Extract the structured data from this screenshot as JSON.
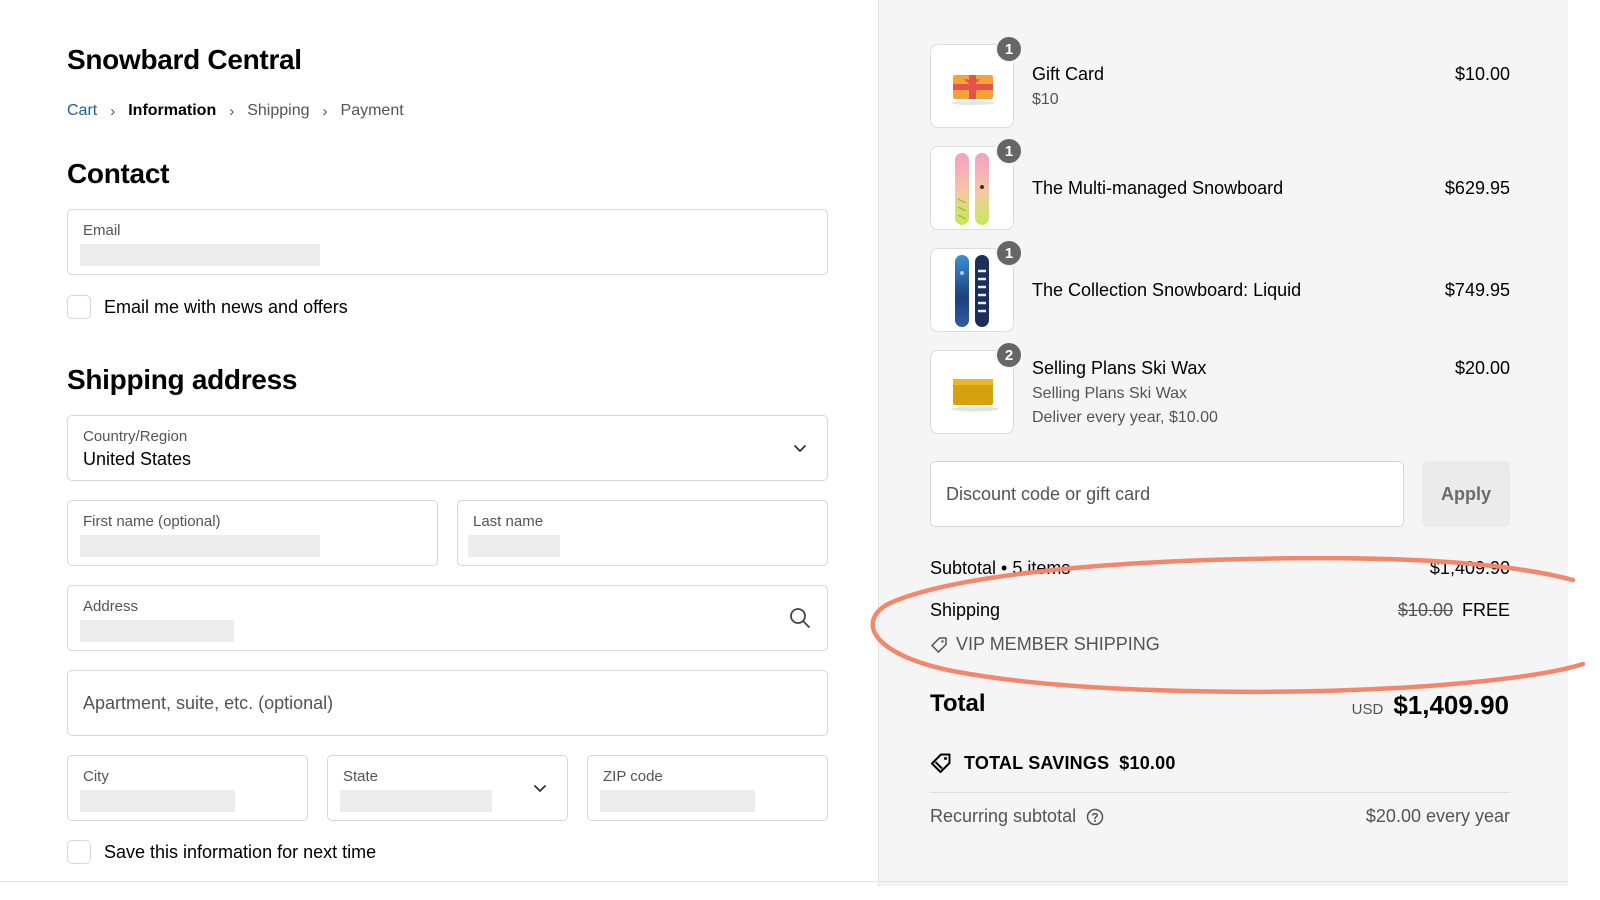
{
  "store": {
    "name": "Snowbard Central"
  },
  "breadcrumb": [
    {
      "label": "Cart",
      "state": "link"
    },
    {
      "label": "Information",
      "state": "current"
    },
    {
      "label": "Shipping",
      "state": "upcoming"
    },
    {
      "label": "Payment",
      "state": "upcoming"
    }
  ],
  "contact": {
    "heading": "Contact",
    "email_label": "Email",
    "newsletter_label": "Email me with news and offers"
  },
  "shipping_address": {
    "heading": "Shipping address",
    "country_label": "Country/Region",
    "country_value": "United States",
    "first_name_label": "First name (optional)",
    "last_name_label": "Last name",
    "address_label": "Address",
    "apartment_placeholder": "Apartment, suite, etc. (optional)",
    "city_label": "City",
    "state_label": "State",
    "zip_label": "ZIP code",
    "save_info_label": "Save this information for next time"
  },
  "order": {
    "items": [
      {
        "name": "Gift Card",
        "sub": [
          "$10"
        ],
        "price": "$10.00",
        "qty": "1",
        "icon": "gift-card-icon"
      },
      {
        "name": "The Multi-managed Snowboard",
        "sub": [],
        "price": "$629.95",
        "qty": "1",
        "icon": "snowboard-icon"
      },
      {
        "name": "The Collection Snowboard: Liquid",
        "sub": [],
        "price": "$749.95",
        "qty": "1",
        "icon": "snowboard-icon"
      },
      {
        "name": "Selling Plans Ski Wax",
        "sub": [
          "Selling Plans Ski Wax",
          "Deliver every year, $10.00"
        ],
        "price": "$20.00",
        "qty": "2",
        "icon": "ski-wax-icon"
      }
    ],
    "discount_placeholder": "Discount code or gift card",
    "apply_label": "Apply",
    "subtotal_label": "Subtotal • 5 items",
    "subtotal_value": "$1,409.90",
    "shipping_label": "Shipping",
    "shipping_original": "$10.00",
    "shipping_value": "FREE",
    "shipping_discount_name": "VIP MEMBER SHIPPING",
    "total_label": "Total",
    "total_currency": "USD",
    "total_value": "$1,409.90",
    "savings_label": "TOTAL SAVINGS",
    "savings_value": "$10.00",
    "recurring_label": "Recurring subtotal",
    "recurring_value": "$20.00 every year"
  },
  "colors": {
    "link": "#1f5f9e",
    "annotation": "#f4866b",
    "summary_bg": "#f5f5f5",
    "badge": "#666666"
  }
}
